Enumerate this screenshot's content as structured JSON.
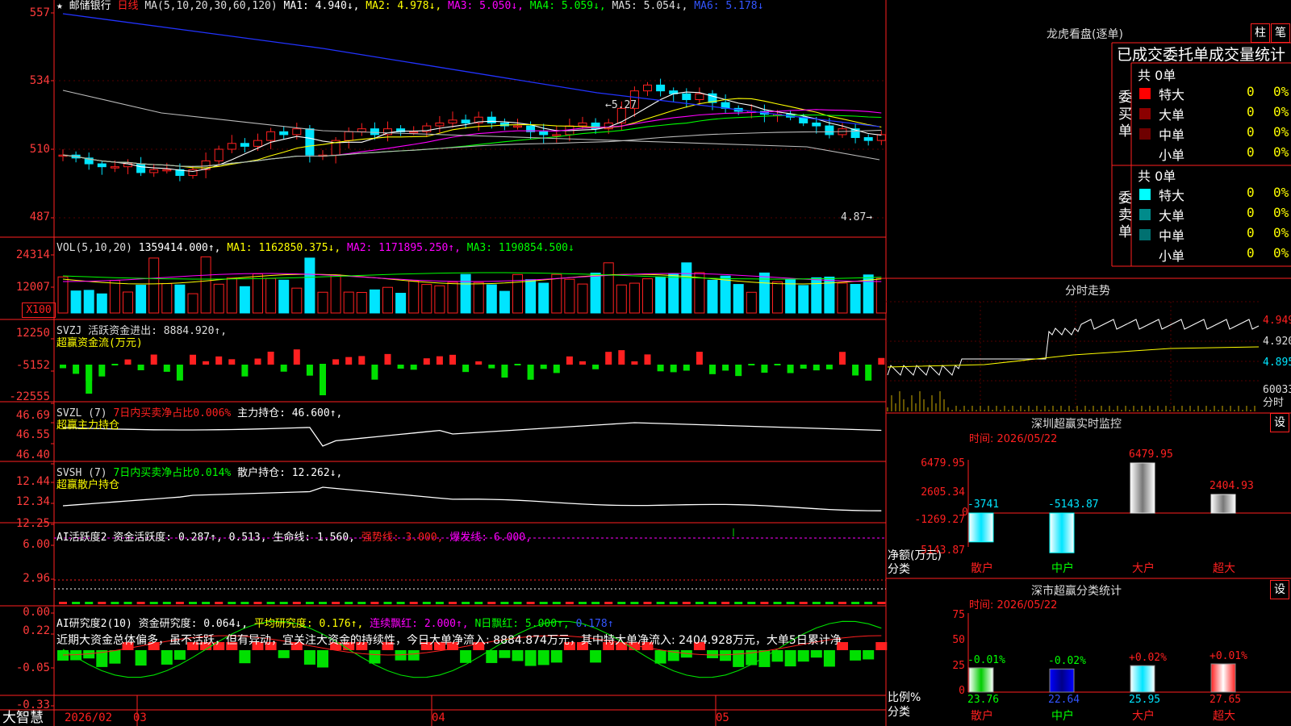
{
  "colors": {
    "up": "#ff2020",
    "down": "#00e5ff",
    "ma1": "#ffffff",
    "ma2": "#ffff00",
    "ma3": "#ff00ff",
    "ma4": "#00ff00",
    "ma5": "#bbbbbb",
    "ma6": "#0000ff",
    "grid": "#ff2020",
    "green": "#00e000",
    "teal": "#008c8c"
  },
  "header": {
    "prefix": "★",
    "stock_name": "邮储银行",
    "period": "日线",
    "ma_label": "MA(5,10,20,30,60,120)",
    "ma1": "MA1: 4.940↓,",
    "ma2": "MA2: 4.978↓,",
    "ma3": "MA3: 5.050↓,",
    "ma4": "MA4: 5.059↓,",
    "ma5": "MA5: 5.054↓,",
    "ma6": "MA6: 5.178↓"
  },
  "price_panel": {
    "y_labels": [
      "557",
      "534",
      "510",
      "487"
    ],
    "high_note": "←5.27",
    "low_note": "4.87→"
  },
  "vol_panel": {
    "label": "VOL(5,10,20)",
    "value": "1359414.000↑,",
    "ma1": "MA1: 1162850.375↓,",
    "ma2": "MA2: 1171895.250↑,",
    "ma3": "MA3: 1190854.500↓",
    "y_labels": [
      "24314",
      "12007"
    ],
    "unit": "X100"
  },
  "svzj_panel": {
    "label": "SVZJ  活跃资金进出: 8884.920↑,",
    "sub": "超赢资金流(万元)",
    "y_labels": [
      "12250",
      "-5152",
      "-22555"
    ]
  },
  "svzl_panel": {
    "label": "SVZL (7)",
    "ratio": "7日内买卖净占比0.006%",
    "hold": "主力持仓: 46.600↑,",
    "sub": "超赢主力持仓",
    "y_labels": [
      "46.69",
      "46.55",
      "46.40"
    ]
  },
  "svsh_panel": {
    "label": "SVSH (7)",
    "ratio": "7日内买卖净占比0.014%",
    "hold": "散户持仓: 12.262↓,",
    "sub": "超赢散户持仓",
    "y_labels": [
      "12.44",
      "12.34",
      "12.25"
    ]
  },
  "ai_active": {
    "label": "AI活跃度2 资金活跃度: 0.287↑, 0.513, 生命线: 1.560,",
    "strong": "强势线: 3.000,",
    "burst": "爆发线: 6.000,",
    "y_labels": [
      "6.00",
      "2.96",
      "0.00"
    ]
  },
  "ai_research": {
    "label": "AI研究度2(10) 资金研究度: 0.064↓,",
    "avg": "平均研究度: 0.176↑,",
    "streak": "连续飘红: 2.000↑,",
    "n_red": "N日飘红: 5.000↑,",
    "last": "0.178↑",
    "comment": "近期大资金总体偏多，虽不活跃，但有异动，宜关注大资金的持续性，今日大单净流入: 8884.874万元，其中特大单净流入: 2404.928万元，大单5日累计净",
    "y_labels": [
      "0.22",
      "-0.05",
      "-0.33"
    ]
  },
  "bottom_bar": {
    "brand": "大智慧",
    "dates": [
      "2026/02",
      "03",
      "04",
      "05"
    ]
  },
  "right_top": {
    "title": "龙虎看盘(逐单)",
    "btn1": "柱",
    "btn2": "笔",
    "subtitle": "已成交委托单成交量统计",
    "buy_label": "委买单",
    "sell_label": "委卖单",
    "buy_total": "共 0单",
    "sell_total": "共 0单",
    "buy_rows": [
      {
        "name": "特大",
        "count": "0",
        "pct": "0%",
        "color": "#ff0000"
      },
      {
        "name": "大单",
        "count": "0",
        "pct": "0%",
        "color": "#8b0000"
      },
      {
        "name": "中单",
        "count": "0",
        "pct": "0%",
        "color": "#6e0000"
      },
      {
        "name": "小单",
        "count": "0",
        "pct": "0%",
        "color": "#000000"
      }
    ],
    "sell_rows": [
      {
        "name": "特大",
        "count": "0",
        "pct": "0%",
        "color": "#00ffff"
      },
      {
        "name": "大单",
        "count": "0",
        "pct": "0%",
        "color": "#008b8b"
      },
      {
        "name": "中单",
        "count": "0",
        "pct": "0%",
        "color": "#007070"
      },
      {
        "name": "小单",
        "count": "0",
        "pct": "0%",
        "color": "#000000"
      }
    ]
  },
  "intraday": {
    "title": "分时走势",
    "y_labels": [
      "4.949",
      "4.920",
      "4.895",
      "60033"
    ],
    "unit": "分时"
  },
  "sz_monitor": {
    "title": "深圳超赢实时监控",
    "btn": "设",
    "time": "时间: 2026/05/22",
    "y_labels": [
      "6479.95",
      "2605.34",
      "-1269.27",
      "-5143.87"
    ],
    "axis_title": "净额(万元)",
    "axis_sub": "分类",
    "bars": [
      {
        "name": "散户",
        "value": -3741,
        "label": "-3741"
      },
      {
        "name": "中户",
        "value": -5143.87,
        "label": "-5143.87"
      },
      {
        "name": "大户",
        "value": 6479.95,
        "label": "6479.95"
      },
      {
        "name": "超大",
        "value": 2404.93,
        "label": "2404.93"
      }
    ],
    "zero": "0"
  },
  "sz_class": {
    "title": "深市超赢分类统计",
    "btn": "设",
    "time": "时间: 2026/05/22",
    "y_labels": [
      "75",
      "50",
      "25",
      "0"
    ],
    "axis_title": "比例%",
    "axis_sub": "分类",
    "bars": [
      {
        "name": "散户",
        "value": 23.76,
        "label": "23.76",
        "change": "-0.01%"
      },
      {
        "name": "中户",
        "value": 22.64,
        "label": "22.64",
        "change": "-0.02%"
      },
      {
        "name": "大户",
        "value": 25.95,
        "label": "25.95",
        "change": "+0.02%"
      },
      {
        "name": "超大",
        "value": 27.65,
        "label": "27.65",
        "change": "+0.01%"
      }
    ]
  }
}
